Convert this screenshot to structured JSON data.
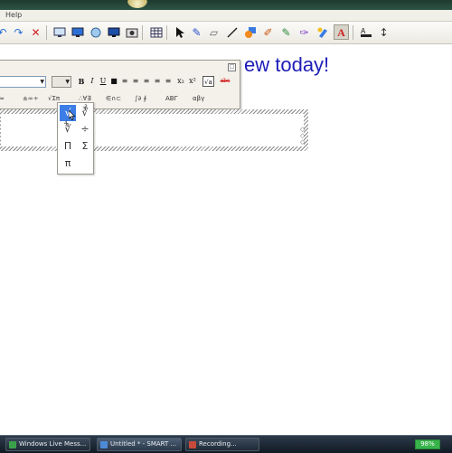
{
  "menubar": {
    "help_label": "Help"
  },
  "toolbar": {
    "icons": [
      "undo-icon",
      "redo-icon",
      "delete-icon",
      "screen-shade-icon",
      "screen-capture-icon",
      "spotlight-icon",
      "monitor-icon",
      "document-camera-icon",
      "table-icon",
      "select-pointer-icon",
      "pen-icon",
      "eraser-icon",
      "line-icon",
      "shape-icon",
      "creative-pen-icon",
      "magic-pen-icon",
      "fill-icon",
      "properties-icon",
      "text-icon",
      "font-color-icon",
      "move-toolbar-icon"
    ]
  },
  "canvas": {
    "text_left": "",
    "text_right": "ew today!",
    "text_color": "#1d1db8"
  },
  "format_panel": {
    "font_value": "",
    "size_value": "",
    "buttons": [
      "B",
      "I",
      "U",
      "■",
      "≡",
      "≡",
      "≡",
      "≡",
      "≡",
      "x₂",
      "x²",
      "√a",
      "abc"
    ],
    "symbol_groups": [
      "≈",
      "±∞÷",
      "√Σπ",
      "∴∀∃",
      "∈∩⊂",
      "∫∂ ∮",
      "ΑΒΓ",
      "αβγ"
    ]
  },
  "symbol_menu": {
    "items": [
      "√",
      "∛",
      "∜",
      "÷",
      "Π",
      "Σ",
      "π"
    ],
    "root3_index": "3",
    "root4_index": "4",
    "highlight_color": "#3d7ee6"
  },
  "taskbar": {
    "tasks": [
      {
        "label": "Windows Live Mess..."
      },
      {
        "label": "Untitled * - SMART ..."
      },
      {
        "label": "Recording..."
      }
    ],
    "battery": "98%"
  }
}
